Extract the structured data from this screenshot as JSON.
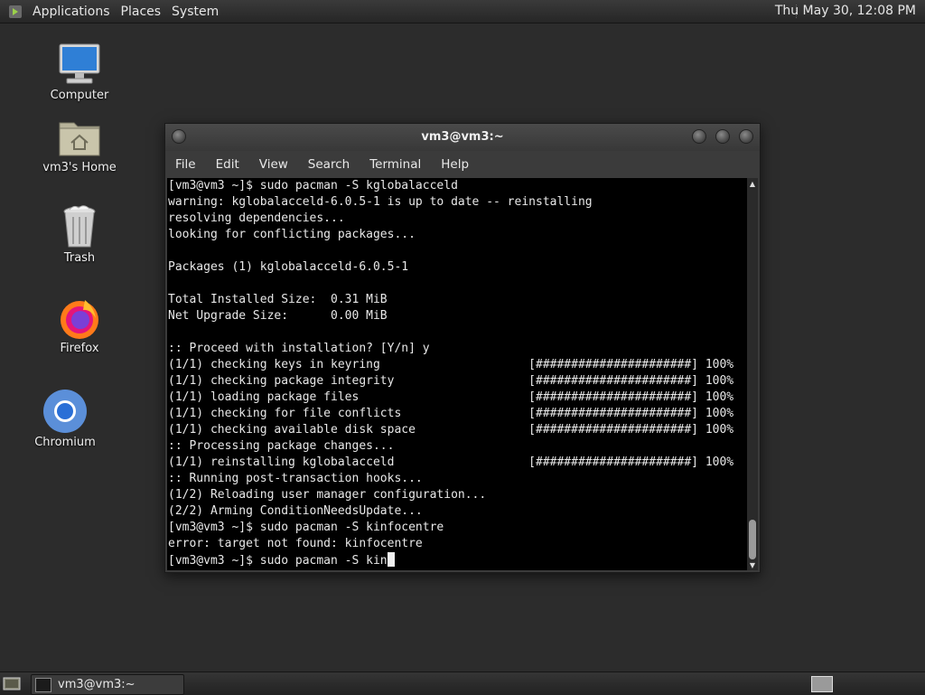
{
  "top_panel": {
    "menus": [
      "Applications",
      "Places",
      "System"
    ],
    "clock": "Thu May 30, 12:08 PM"
  },
  "desktop_icons": [
    {
      "label": "Computer",
      "icon": "computer-icon"
    },
    {
      "label": "vm3's Home",
      "icon": "home-folder-icon"
    },
    {
      "label": "Trash",
      "icon": "trash-icon"
    },
    {
      "label": "Firefox",
      "icon": "firefox-icon"
    },
    {
      "label": "Chromium",
      "icon": "chromium-icon"
    }
  ],
  "terminal": {
    "title": "vm3@vm3:~",
    "menu": [
      "File",
      "Edit",
      "View",
      "Search",
      "Terminal",
      "Help"
    ],
    "lines": [
      "[vm3@vm3 ~]$ sudo pacman -S kglobalacceld",
      "warning: kglobalacceld-6.0.5-1 is up to date -- reinstalling",
      "resolving dependencies...",
      "looking for conflicting packages...",
      "",
      "Packages (1) kglobalacceld-6.0.5-1",
      "",
      "Total Installed Size:  0.31 MiB",
      "Net Upgrade Size:      0.00 MiB",
      "",
      ":: Proceed with installation? [Y/n] y",
      "(1/1) checking keys in keyring                     [######################] 100%",
      "(1/1) checking package integrity                   [######################] 100%",
      "(1/1) loading package files                        [######################] 100%",
      "(1/1) checking for file conflicts                  [######################] 100%",
      "(1/1) checking available disk space                [######################] 100%",
      ":: Processing package changes...",
      "(1/1) reinstalling kglobalacceld                   [######################] 100%",
      ":: Running post-transaction hooks...",
      "(1/2) Reloading user manager configuration...",
      "(2/2) Arming ConditionNeedsUpdate...",
      "[vm3@vm3 ~]$ sudo pacman -S kinfocentre",
      "error: target not found: kinfocentre"
    ],
    "current_prompt": "[vm3@vm3 ~]$ sudo pacman -S kin"
  },
  "taskbar": {
    "task_label": "vm3@vm3:~"
  }
}
